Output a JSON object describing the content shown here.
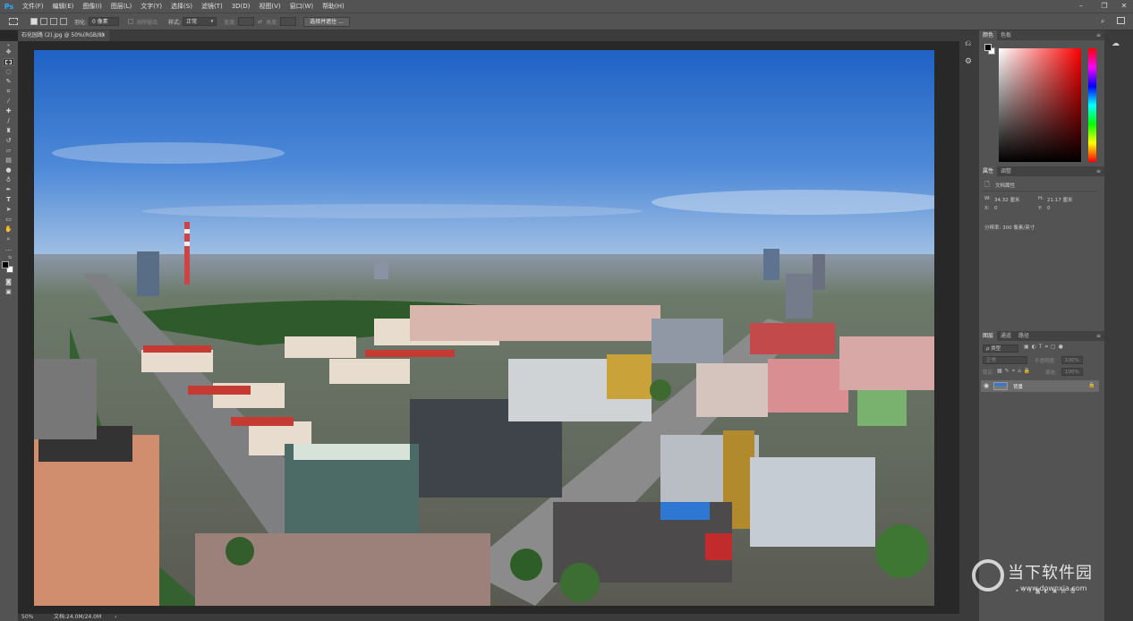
{
  "app": {
    "logo": "Ps"
  },
  "menu": [
    "文件(F)",
    "编辑(E)",
    "图像(I)",
    "图层(L)",
    "文字(Y)",
    "选择(S)",
    "滤镜(T)",
    "3D(D)",
    "视图(V)",
    "窗口(W)",
    "帮助(H)"
  ],
  "options": {
    "feather_label": "羽化:",
    "feather_value": "0 像素",
    "antialias_label": "消除锯齿",
    "style_label": "样式:",
    "style_value": "正常",
    "width_label": "宽度:",
    "height_label": "高度:",
    "select_mask_button": "选择并遮住 ..."
  },
  "document": {
    "tab_title": "石化园路 (2).jpg @ 50%(RGB/8)",
    "close": "×"
  },
  "status": {
    "zoom": "50%",
    "doc_info": "文档:24.0M/24.0M"
  },
  "color_panel": {
    "tabs": [
      "颜色",
      "色板"
    ]
  },
  "properties_panel": {
    "tabs": [
      "属性",
      "调整"
    ],
    "title": "文档属性",
    "w_label": "W:",
    "w_value": "34.32 厘米",
    "h_label": "H:",
    "h_value": "21.17 厘米",
    "x_label": "X:",
    "x_value": "0",
    "y_label": "Y:",
    "y_value": "0",
    "resolution": "分辨率: 300 像素/英寸"
  },
  "layers_panel": {
    "tabs": [
      "图层",
      "通道",
      "路径"
    ],
    "filter_kind": "ρ 类型",
    "blend_mode": "正常",
    "opacity_label": "不透明度:",
    "opacity_value": "100%",
    "lock_label": "锁定:",
    "fill_label": "填充:",
    "fill_value": "100%",
    "layers": [
      {
        "name": "背景"
      }
    ]
  },
  "watermark": {
    "brand": "当下软件园",
    "url": "www.downxia.com"
  },
  "colors": {
    "chrome": "#535353",
    "workspace": "#282828",
    "accent": "#31a8ff",
    "fg_swatch": "#000000",
    "bg_swatch": "#ffffff"
  }
}
